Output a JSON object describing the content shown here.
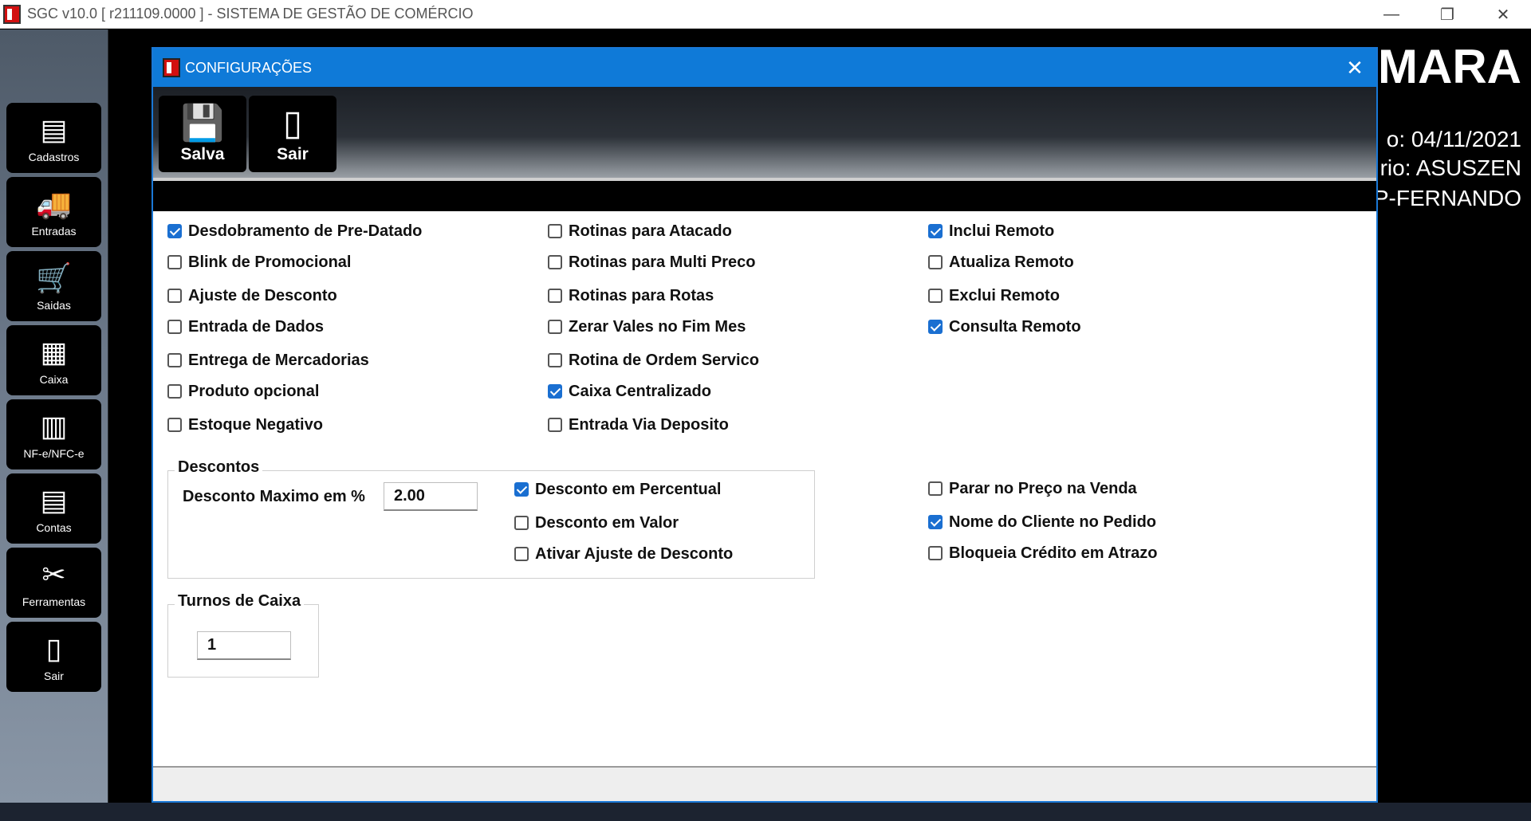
{
  "window": {
    "title": "SGC v10.0 [ r211109.0000 ] - SISTEMA DE GESTÃO DE COMÉRCIO",
    "minimize_glyph": "—",
    "maximize_glyph": "❐",
    "close_glyph": "✕"
  },
  "sidebar": {
    "items": [
      {
        "label": "Cadastros",
        "icon": "▤"
      },
      {
        "label": "Entradas",
        "icon": "🚚"
      },
      {
        "label": "Saidas",
        "icon": "🛒"
      },
      {
        "label": "Caixa",
        "icon": "▦"
      },
      {
        "label": "NF-e/NFC-e",
        "icon": "▥"
      },
      {
        "label": "Contas",
        "icon": "▤"
      },
      {
        "label": "Ferramentas",
        "icon": "✂"
      },
      {
        "label": "Sair",
        "icon": "▯"
      }
    ]
  },
  "background": {
    "title": "MARA",
    "line1": "o: 04/11/2021",
    "line2": "rio: ASUSZEN",
    "line3": "P-FERNANDO"
  },
  "dialog": {
    "title": "CONFIGURAÇÕES",
    "close_glyph": "✕",
    "toolbar": {
      "save_label": "Salva",
      "save_icon": "💾",
      "exit_label": "Sair",
      "exit_icon": "▯"
    },
    "checkboxes": {
      "col1": [
        {
          "label": "Desdobramento de Pre-Datado",
          "checked": true
        },
        {
          "label": "Blink de Promocional",
          "checked": false
        },
        {
          "label": "Ajuste de Desconto",
          "checked": false
        },
        {
          "label": "Entrada de Dados",
          "checked": false
        },
        {
          "label": "Entrega de Mercadorias",
          "checked": false
        },
        {
          "label": "Produto opcional",
          "checked": false
        },
        {
          "label": "Estoque Negativo",
          "checked": false
        }
      ],
      "col2": [
        {
          "label": "Rotinas para Atacado",
          "checked": false
        },
        {
          "label": "Rotinas para Multi Preco",
          "checked": false
        },
        {
          "label": "Rotinas para Rotas",
          "checked": false
        },
        {
          "label": "Zerar Vales no Fim Mes",
          "checked": false
        },
        {
          "label": "Rotina de Ordem Servico",
          "checked": false
        },
        {
          "label": "Caixa Centralizado",
          "checked": true
        },
        {
          "label": "Entrada Via Deposito",
          "checked": false
        }
      ],
      "col3": [
        {
          "label": "Inclui Remoto",
          "checked": true
        },
        {
          "label": "Atualiza Remoto",
          "checked": false
        },
        {
          "label": "Exclui Remoto",
          "checked": false
        },
        {
          "label": "Consulta Remoto",
          "checked": true
        }
      ]
    },
    "descontos": {
      "legend": "Descontos",
      "max_label": "Desconto Maximo em %",
      "max_value": "2.00",
      "options": [
        {
          "label": "Desconto em Percentual",
          "checked": true
        },
        {
          "label": "Desconto em Valor",
          "checked": false
        },
        {
          "label": "Ativar Ajuste de Desconto",
          "checked": false
        }
      ]
    },
    "right_options": [
      {
        "label": "Parar no Preço na Venda",
        "checked": false
      },
      {
        "label": "Nome do Cliente no Pedido",
        "checked": true
      },
      {
        "label": "Bloqueia Crédito em Atrazo",
        "checked": false
      }
    ],
    "turnos": {
      "legend": "Turnos de Caixa",
      "value": "1"
    }
  }
}
